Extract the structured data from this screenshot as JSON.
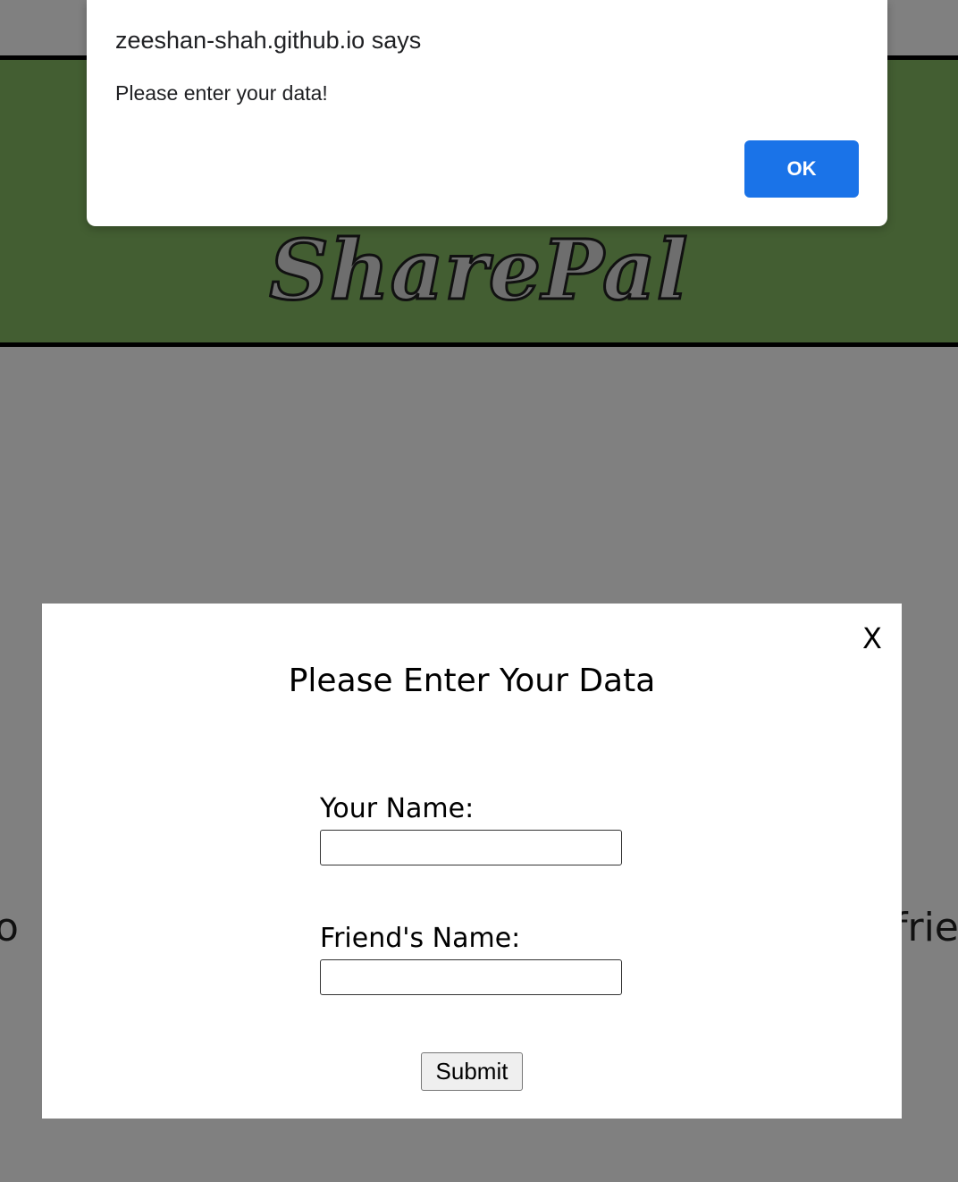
{
  "site": {
    "logo_text": "SharePal",
    "bg_text_left": "o",
    "bg_text_right": "frie"
  },
  "alert": {
    "title": "zeeshan-shah.github.io says",
    "message": "Please enter your data!",
    "ok_label": "OK"
  },
  "modal": {
    "close_label": "X",
    "title": "Please Enter Your Data",
    "your_name_label": "Your Name:",
    "your_name_value": "",
    "friend_name_label": "Friend's Name:",
    "friend_name_value": "",
    "submit_label": "Submit"
  },
  "colors": {
    "header_bg": "#435e32",
    "page_bg": "#808080",
    "ok_button": "#1a73e8"
  }
}
